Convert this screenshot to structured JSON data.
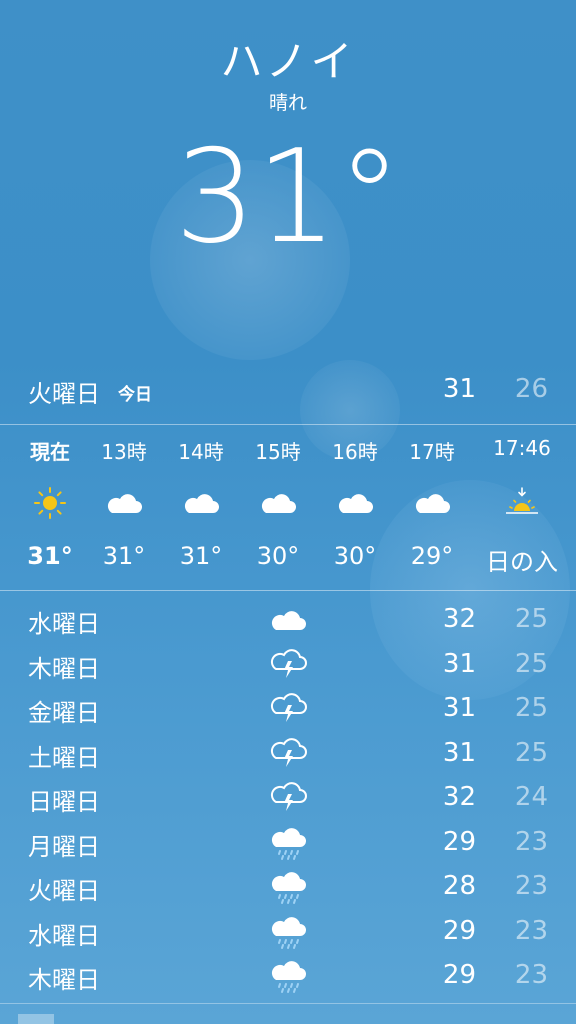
{
  "header": {
    "city": "ハノイ",
    "condition": "晴れ",
    "temperature": "31°"
  },
  "today": {
    "day": "火曜日",
    "tag": "今日",
    "high": "31",
    "low": "26"
  },
  "hourly": [
    {
      "time": "現在",
      "icon": "sun-icon",
      "value": "31°"
    },
    {
      "time": "13時",
      "icon": "cloud-icon",
      "value": "31°"
    },
    {
      "time": "14時",
      "icon": "cloud-icon",
      "value": "31°"
    },
    {
      "time": "15時",
      "icon": "cloud-icon",
      "value": "30°"
    },
    {
      "time": "16時",
      "icon": "cloud-icon",
      "value": "30°"
    },
    {
      "time": "17時",
      "icon": "cloud-icon",
      "value": "29°"
    },
    {
      "time": "17:46",
      "icon": "sunset-icon",
      "value": "日の入"
    }
  ],
  "daily": [
    {
      "day": "水曜日",
      "icon": "cloud-icon",
      "high": "32",
      "low": "25"
    },
    {
      "day": "木曜日",
      "icon": "thunderstorm-icon",
      "high": "31",
      "low": "25"
    },
    {
      "day": "金曜日",
      "icon": "thunderstorm-icon",
      "high": "31",
      "low": "25"
    },
    {
      "day": "土曜日",
      "icon": "thunderstorm-icon",
      "high": "31",
      "low": "25"
    },
    {
      "day": "日曜日",
      "icon": "thunderstorm-icon",
      "high": "32",
      "low": "24"
    },
    {
      "day": "月曜日",
      "icon": "rain-icon",
      "high": "29",
      "low": "23"
    },
    {
      "day": "火曜日",
      "icon": "rain-icon",
      "high": "28",
      "low": "23"
    },
    {
      "day": "水曜日",
      "icon": "rain-icon",
      "high": "29",
      "low": "23"
    },
    {
      "day": "木曜日",
      "icon": "rain-icon",
      "high": "29",
      "low": "23"
    }
  ],
  "colors": {
    "background": "#3f90c8",
    "sun": "#f5c518",
    "rain": "#9ed2f5"
  }
}
